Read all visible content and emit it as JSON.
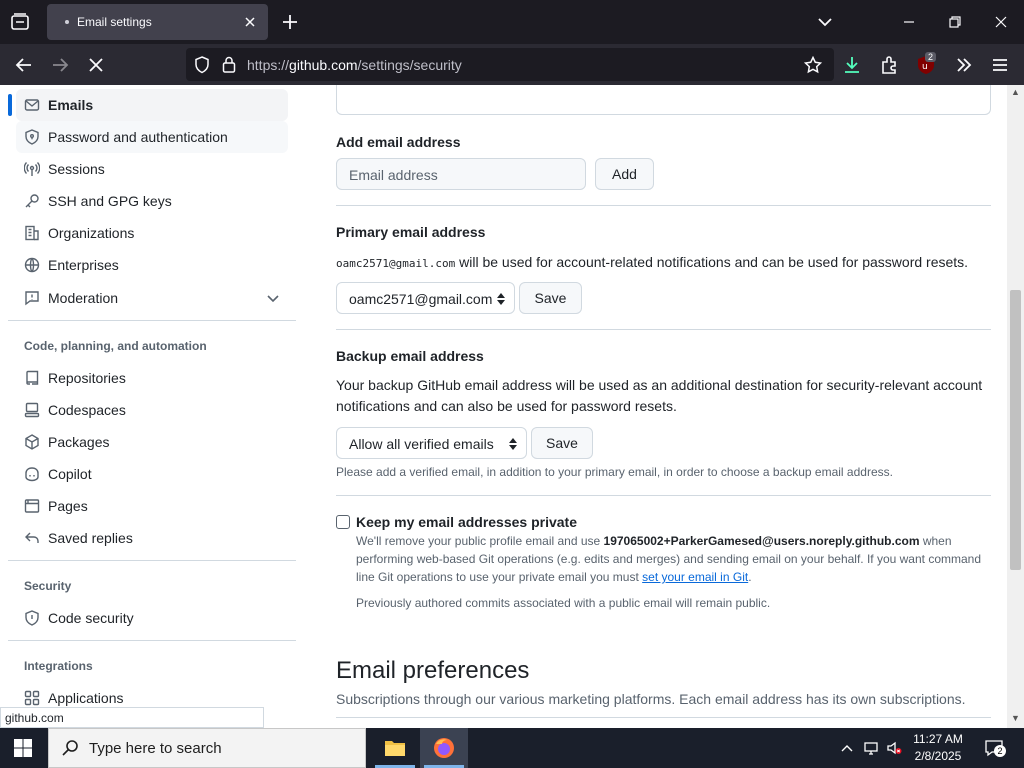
{
  "browser": {
    "tab_title": "Email settings",
    "url_prefix": "https://",
    "url_domain": "github.com",
    "url_path": "/settings/security",
    "extension_badge": "2"
  },
  "sidebar": {
    "items": [
      {
        "label": "Emails"
      },
      {
        "label": "Password and authentication"
      },
      {
        "label": "Sessions"
      },
      {
        "label": "SSH and GPG keys"
      },
      {
        "label": "Organizations"
      },
      {
        "label": "Enterprises"
      },
      {
        "label": "Moderation"
      }
    ],
    "section_code": "Code, planning, and automation",
    "code_items": [
      {
        "label": "Repositories"
      },
      {
        "label": "Codespaces"
      },
      {
        "label": "Packages"
      },
      {
        "label": "Copilot"
      },
      {
        "label": "Pages"
      },
      {
        "label": "Saved replies"
      }
    ],
    "section_security": "Security",
    "security_items": [
      {
        "label": "Code security"
      }
    ],
    "section_integrations": "Integrations",
    "integration_items": [
      {
        "label": "Applications"
      }
    ]
  },
  "main": {
    "add_email_title": "Add email address",
    "email_placeholder": "Email address",
    "add_button": "Add",
    "primary_title": "Primary email address",
    "primary_email_mono": "oamc2571@gmail.com",
    "primary_desc": "will be used for account-related notifications and can be used for password resets.",
    "primary_select_value": "oamc2571@gmail.com",
    "save_button": "Save",
    "backup_title": "Backup email address",
    "backup_desc_1": "Your backup GitHub email address will be used as an additional destination for security-relevant account",
    "backup_desc_2": "notifications and can also be used for password resets.",
    "backup_select_value": "Allow all verified emails",
    "backup_note": "Please add a verified email, in addition to your primary email, in order to choose a backup email address.",
    "private_label": "Keep my email addresses private",
    "private_desc_1a": "We'll remove your public profile email and use",
    "private_noreply": "197065002+ParkerGamesed@users.noreply.github.com",
    "private_desc_1b": "when",
    "private_desc_2": "performing web-based Git operations (e.g. edits and merges) and sending email on your behalf. If you want command",
    "private_desc_3a": "line Git operations to use your private email you must",
    "private_link": "set your email in Git",
    "private_desc_3b": ".",
    "private_note": "Previously authored commits associated with a public email will remain public.",
    "prefs_title": "Email preferences",
    "prefs_desc": "Subscriptions through our various marketing platforms. Each email address has its own subscriptions."
  },
  "status_bar_url": "github.com",
  "taskbar": {
    "search_placeholder": "Type here to search",
    "time": "11:27 AM",
    "date": "2/8/2025",
    "notification_count": "2"
  },
  "colors": {
    "accent": "#0969da",
    "browser_dark": "#1c1b22",
    "taskbar": "#1a1f2b"
  }
}
